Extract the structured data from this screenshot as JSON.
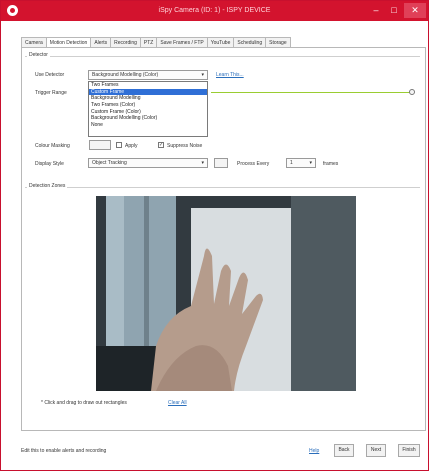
{
  "window": {
    "title": "iSpy Camera (ID: 1) - ISPY DEVICE",
    "min_label": "–",
    "max_label": "□",
    "close_label": "✕"
  },
  "tabs": [
    "Camera",
    "Motion Detection",
    "Alerts",
    "Recording",
    "PTZ",
    "Save Frames / FTP",
    "YouTube",
    "Scheduling",
    "Storage"
  ],
  "detector": {
    "group_label": "Detector",
    "use_detector_label": "Use Detector",
    "selected": "Background Modelling (Color)",
    "help_link": "Learn This...",
    "options": [
      "Two Frames",
      "Custom Frame",
      "Background Modelling",
      "Two Frames (Color)",
      "Custom Frame (Color)",
      "Background Modelling (Color)",
      "None"
    ],
    "highlighted_index": 1,
    "trigger_range_label": "Trigger Range",
    "colour_masking_label": "Colour Masking",
    "apply_label": "Apply",
    "suppress_noise_label": "Suppress Noise",
    "display_style_label": "Display Style",
    "display_style_value": "Object Tracking",
    "process_every_label": "Process Every",
    "process_every_value": "1",
    "frames_label": "frames"
  },
  "zones": {
    "group_label": "Detection Zones",
    "hint": "* Click and drag to draw out rectangles",
    "clear_link": "Clear All"
  },
  "footer": {
    "status": "Edit this to enable alerts and recording",
    "help": "Help",
    "back": "Back",
    "next": "Next",
    "finish": "Finish"
  }
}
